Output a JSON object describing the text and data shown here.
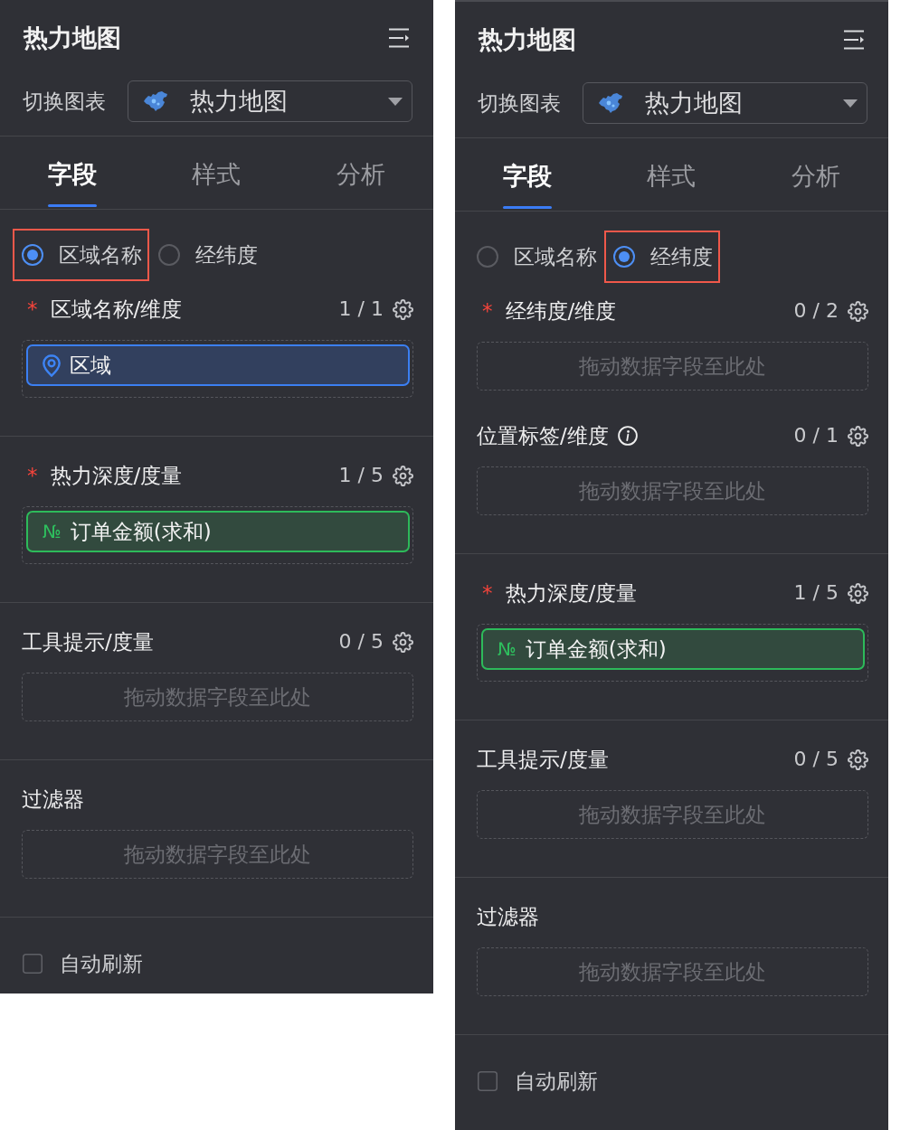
{
  "panels": [
    {
      "title": "热力地图",
      "chart_switch": {
        "label": "切换图表",
        "value": "热力地图"
      },
      "tabs": [
        {
          "label": "字段",
          "selected": true
        },
        {
          "label": "样式",
          "selected": false
        },
        {
          "label": "分析",
          "selected": false
        }
      ],
      "location_modes": [
        {
          "label": "区域名称",
          "selected": true,
          "highlighted": true
        },
        {
          "label": "经纬度",
          "selected": false,
          "highlighted": false
        }
      ],
      "groups": [
        {
          "sections": [
            {
              "title": "区域名称/维度",
              "required_mark": "*",
              "count": "1 / 1",
              "fields": [
                {
                  "kind": "dimension",
                  "label": "区域"
                }
              ]
            }
          ]
        },
        {
          "sections": [
            {
              "title": "热力深度/度量",
              "required_mark": "*",
              "count": "1 / 5",
              "fields": [
                {
                  "kind": "measure",
                  "symbol": "№",
                  "label": "订单金额(求和)"
                }
              ]
            }
          ]
        },
        {
          "sections": [
            {
              "title": "工具提示/度量",
              "count": "0 / 5",
              "placeholder": "拖动数据字段至此处"
            }
          ]
        },
        {
          "sections": [
            {
              "title": "过滤器",
              "placeholder": "拖动数据字段至此处"
            }
          ]
        }
      ],
      "auto_refresh": {
        "label": "自动刷新",
        "checked": false
      }
    },
    {
      "title": "热力地图",
      "chart_switch": {
        "label": "切换图表",
        "value": "热力地图"
      },
      "tabs": [
        {
          "label": "字段",
          "selected": true
        },
        {
          "label": "样式",
          "selected": false
        },
        {
          "label": "分析",
          "selected": false
        }
      ],
      "location_modes": [
        {
          "label": "区域名称",
          "selected": false,
          "highlighted": false
        },
        {
          "label": "经纬度",
          "selected": true,
          "highlighted": true
        }
      ],
      "groups": [
        {
          "sections": [
            {
              "title": "经纬度/维度",
              "required_mark": "*",
              "count": "0 / 2",
              "placeholder": "拖动数据字段至此处"
            },
            {
              "title": "位置标签/维度",
              "info": true,
              "count": "0 / 1",
              "placeholder": "拖动数据字段至此处"
            }
          ]
        },
        {
          "sections": [
            {
              "title": "热力深度/度量",
              "required_mark": "*",
              "count": "1 / 5",
              "fields": [
                {
                  "kind": "measure",
                  "symbol": "№",
                  "label": "订单金额(求和)"
                }
              ]
            }
          ]
        },
        {
          "sections": [
            {
              "title": "工具提示/度量",
              "count": "0 / 5",
              "placeholder": "拖动数据字段至此处"
            }
          ]
        },
        {
          "sections": [
            {
              "title": "过滤器",
              "placeholder": "拖动数据字段至此处"
            }
          ]
        }
      ],
      "auto_refresh": {
        "label": "自动刷新",
        "checked": false
      }
    }
  ]
}
